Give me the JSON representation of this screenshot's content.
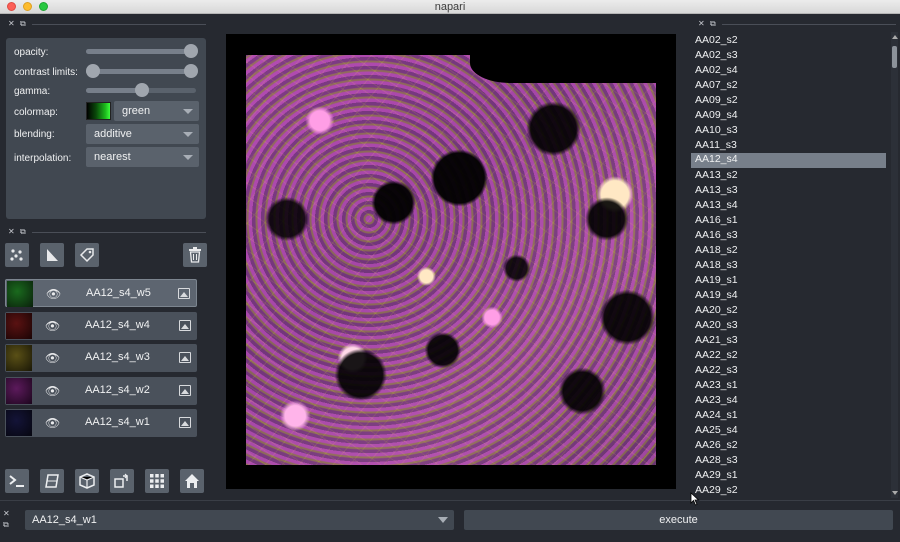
{
  "window": {
    "title": "napari"
  },
  "layer_controls": {
    "opacity_label": "opacity:",
    "opacity_value": 1.0,
    "contrast_label": "contrast limits:",
    "contrast_range": [
      0.0,
      1.0
    ],
    "gamma_label": "gamma:",
    "gamma_value": 0.5,
    "colormap_label": "colormap:",
    "colormap_value": "green",
    "blending_label": "blending:",
    "blending_value": "additive",
    "interpolation_label": "interpolation:",
    "interpolation_value": "nearest"
  },
  "layer_buttons": [
    "new-points",
    "new-shapes",
    "new-labels",
    "delete-layer"
  ],
  "layers": [
    {
      "name": "AA12_s4_w5",
      "selected": true,
      "thumb_color": "#0f3a12"
    },
    {
      "name": "AA12_s4_w4",
      "selected": false,
      "thumb_color": "#3a0a0a"
    },
    {
      "name": "AA12_s4_w3",
      "selected": false,
      "thumb_color": "#3a3410"
    },
    {
      "name": "AA12_s4_w2",
      "selected": false,
      "thumb_color": "#3a0f3a"
    },
    {
      "name": "AA12_s4_w1",
      "selected": false,
      "thumb_color": "#0b0b22"
    }
  ],
  "viewer_buttons": [
    "console",
    "ndisplay",
    "roll-dims",
    "transpose-dims",
    "grid",
    "home"
  ],
  "file_list": {
    "items": [
      "AA02_s2",
      "AA02_s3",
      "AA02_s4",
      "AA07_s2",
      "AA09_s2",
      "AA09_s4",
      "AA10_s3",
      "AA11_s3",
      "AA12_s4",
      "AA13_s2",
      "AA13_s3",
      "AA13_s4",
      "AA16_s1",
      "AA16_s3",
      "AA18_s2",
      "AA18_s3",
      "AA19_s1",
      "AA19_s4",
      "AA20_s2",
      "AA20_s3",
      "AA21_s3",
      "AA22_s2",
      "AA22_s3",
      "AA23_s1",
      "AA23_s4",
      "AA24_s1",
      "AA25_s4",
      "AA26_s2",
      "AA28_s3",
      "AA29_s1",
      "AA29_s2"
    ],
    "selected": "AA12_s4"
  },
  "bottom": {
    "selected_layer": "AA12_s4_w1",
    "execute_label": "execute"
  },
  "colors": {
    "background": "#262930",
    "panel": "#414851",
    "selection": "#777f8a"
  }
}
